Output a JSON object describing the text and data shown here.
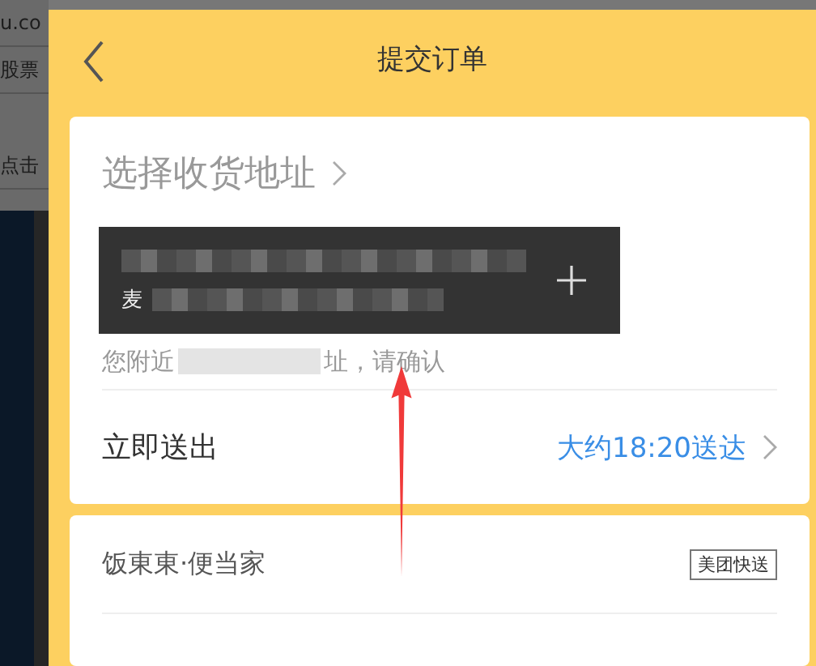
{
  "background_page": {
    "texts": [
      "u.co",
      "股票",
      "点击"
    ]
  },
  "header": {
    "title": "提交订单"
  },
  "address": {
    "label": "选择收货地址",
    "tooltip_visible_text": "麦",
    "hint_parts": [
      "您附近",
      "址，请确认"
    ]
  },
  "delivery": {
    "label": "立即送出",
    "time": "大约18:20送达"
  },
  "shop": {
    "name": "饭東東·便当家",
    "badge": "美团快送"
  }
}
